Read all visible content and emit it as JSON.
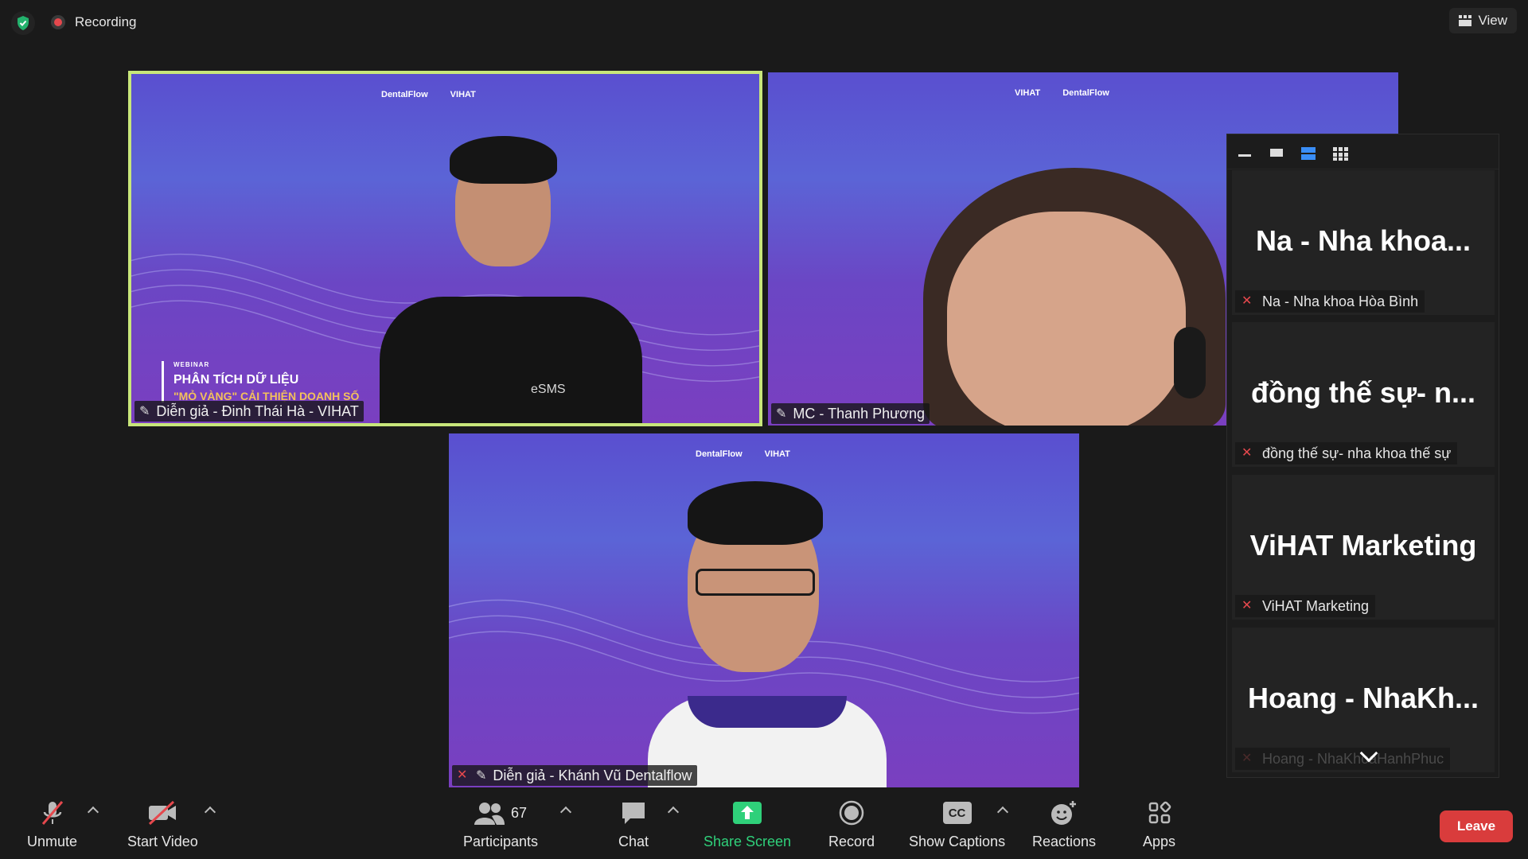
{
  "topbar": {
    "recording_label": "Recording",
    "view_label": "View"
  },
  "tiles": [
    {
      "name": "Diễn giả - Đinh Thái Hà - VIHAT",
      "logos": [
        "DentalFlow",
        "VIHAT"
      ],
      "webinar_tag": "WEBINAR",
      "webinar_title": "PHÂN TÍCH DỮ LIỆU",
      "webinar_subtitle": "\"MỎ VÀNG\" CẢI THIỆN DOANH SỐ",
      "shirt_text": "eSMS",
      "muted": false,
      "active_speaker": true
    },
    {
      "name": "MC - Thanh Phương",
      "logos": [
        "VIHAT",
        "DentalFlow"
      ],
      "muted": false
    },
    {
      "name": "Diễn giả - Khánh Vũ Dentalflow",
      "logos": [
        "DentalFlow",
        "VIHAT"
      ],
      "muted": true
    }
  ],
  "panel": {
    "participants": [
      {
        "display": "Na - Nha khoa...",
        "name": "Na - Nha khoa Hòa Bình",
        "muted": true
      },
      {
        "display": "đồng thế sự- n...",
        "name": "đồng thế sự- nha khoa thế sự",
        "muted": true
      },
      {
        "display": "ViHAT Marketing",
        "name": "ViHAT Marketing",
        "muted": true
      },
      {
        "display": "Hoang - NhaKh...",
        "name": "Hoang - NhaKhoaHanhPhuc",
        "muted": true
      }
    ]
  },
  "toolbar": {
    "unmute": "Unmute",
    "start_video": "Start Video",
    "participants": "Participants",
    "participants_count": "67",
    "chat": "Chat",
    "share_screen": "Share Screen",
    "record": "Record",
    "show_captions": "Show Captions",
    "captions_icon_text": "CC",
    "reactions": "Reactions",
    "apps": "Apps",
    "leave": "Leave"
  },
  "colors": {
    "active_speaker_border": "#c8e67a",
    "leave": "#d93c3c",
    "share_screen": "#2fd07a",
    "muted_red": "#e5484d"
  }
}
